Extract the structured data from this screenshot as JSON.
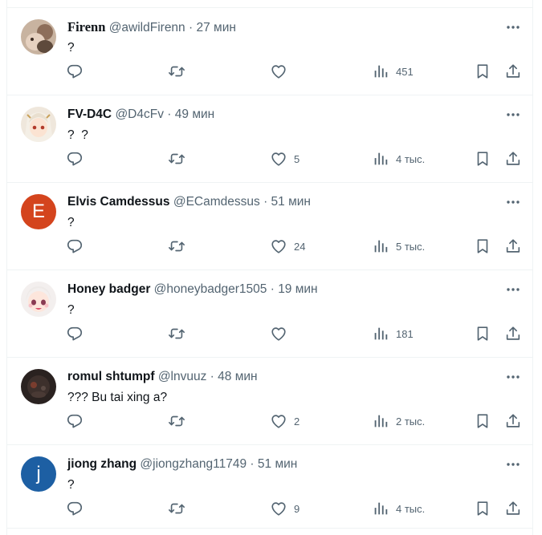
{
  "colors": {
    "icon": "#536471",
    "text": "#0f1419",
    "divider": "#eff3f4",
    "accent": "#1d9bf0"
  },
  "replies": [
    {
      "name": "Firenn",
      "handle": "@awildFirenn",
      "dot": "·",
      "time": "27 мин",
      "text": "?",
      "avatar": {
        "kind": "photo",
        "icon": "avatar-photo"
      },
      "likes": "",
      "views": "451",
      "name_serif": true
    },
    {
      "name": "FV-D4C",
      "handle": "@D4cFv",
      "dot": "·",
      "time": "49 мин",
      "text": "?  ?",
      "avatar": {
        "kind": "anime",
        "icon": "avatar-anime"
      },
      "likes": "5",
      "views": "4 тыс."
    },
    {
      "name": "Elvis Camdessus",
      "handle": "@ECamdessus",
      "dot": "·",
      "time": "51 мин",
      "text": "?",
      "avatar": {
        "kind": "letter",
        "letter": "E",
        "color": "#d4441d"
      },
      "likes": "24",
      "views": "5 тыс."
    },
    {
      "name": "Honey badger",
      "handle": "@honeybadger1505",
      "dot": "·",
      "time": "19 мин",
      "text": "?",
      "avatar": {
        "kind": "anime-pink",
        "icon": "avatar-anime"
      },
      "likes": "",
      "views": "181"
    },
    {
      "name": "romul shtumpf",
      "handle": "@lnvuuz",
      "dot": "·",
      "time": "48 мин",
      "text": "??? Bu tai xing a?",
      "avatar": {
        "kind": "dark",
        "icon": "avatar-photo"
      },
      "likes": "2",
      "views": "2 тыс."
    },
    {
      "name": "jiong zhang",
      "handle": "@jiongzhang11749",
      "dot": "·",
      "time": "51 мин",
      "text": "?",
      "avatar": {
        "kind": "letter",
        "letter": "j",
        "color": "#1d5fa3"
      },
      "likes": "9",
      "views": "4 тыс."
    }
  ]
}
